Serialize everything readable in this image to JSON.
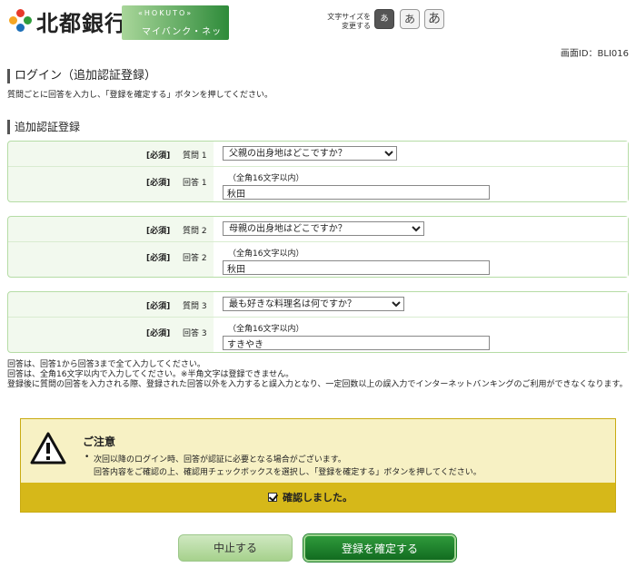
{
  "header": {
    "logo_text": "北都銀行",
    "logo_sub_top": "«HOKUTO»",
    "logo_sub_bottom": "マイバンク・ネット",
    "font_size_label": "文字サイズを\n変更する",
    "font_size_buttons": [
      "あ",
      "あ",
      "あ"
    ]
  },
  "screen_id": "画面ID：BLI016",
  "page": {
    "title": "ログイン（追加認証登録）",
    "intro": "質問ごとに回答を入力し、「登録を確定する」ボタンを押してください。",
    "section_title": "追加認証登録"
  },
  "questions": [
    {
      "required": "[必須]",
      "q_label": "質問 1",
      "selected": "父親の出身地はどこですか？",
      "a_label": "回答 1",
      "hint": "（全角16文字以内）",
      "answer": "秋田"
    },
    {
      "required": "[必須]",
      "q_label": "質問 2",
      "selected": "母親の出身地はどこですか？",
      "a_label": "回答 2",
      "hint": "（全角16文字以内）",
      "answer": "秋田"
    },
    {
      "required": "[必須]",
      "q_label": "質問 3",
      "selected": "最も好きな料理名は何ですか？",
      "a_label": "回答 3",
      "hint": "（全角16文字以内）",
      "answer": "すきやき"
    }
  ],
  "notes": [
    "回答は、回答1から回答3まで全て入力してください。",
    "回答は、全角16文字以内で入力してください。※半角文字は登録できません。",
    "登録後に質問の回答を入力される際、登録された回答以外を入力すると誤入力となり、一定回数以上の誤入力でインターネットバンキングのご利用ができなくなります。"
  ],
  "caution": {
    "title": "ご注意",
    "line1": "次回以降のログイン時、回答が認証に必要となる場合がございます。",
    "line2": "回答内容をご確認の上、確認用チェックボックスを選択し、「登録を確定する」ボタンを押してください。",
    "confirm_label": "確認しました。",
    "confirm_checked": true
  },
  "buttons": {
    "cancel": "中止する",
    "confirm": "登録を確定する"
  },
  "colors": {
    "accent_green": "#1c7d2a",
    "box_border": "#b5dca5",
    "caution_bar": "#d6b819"
  }
}
